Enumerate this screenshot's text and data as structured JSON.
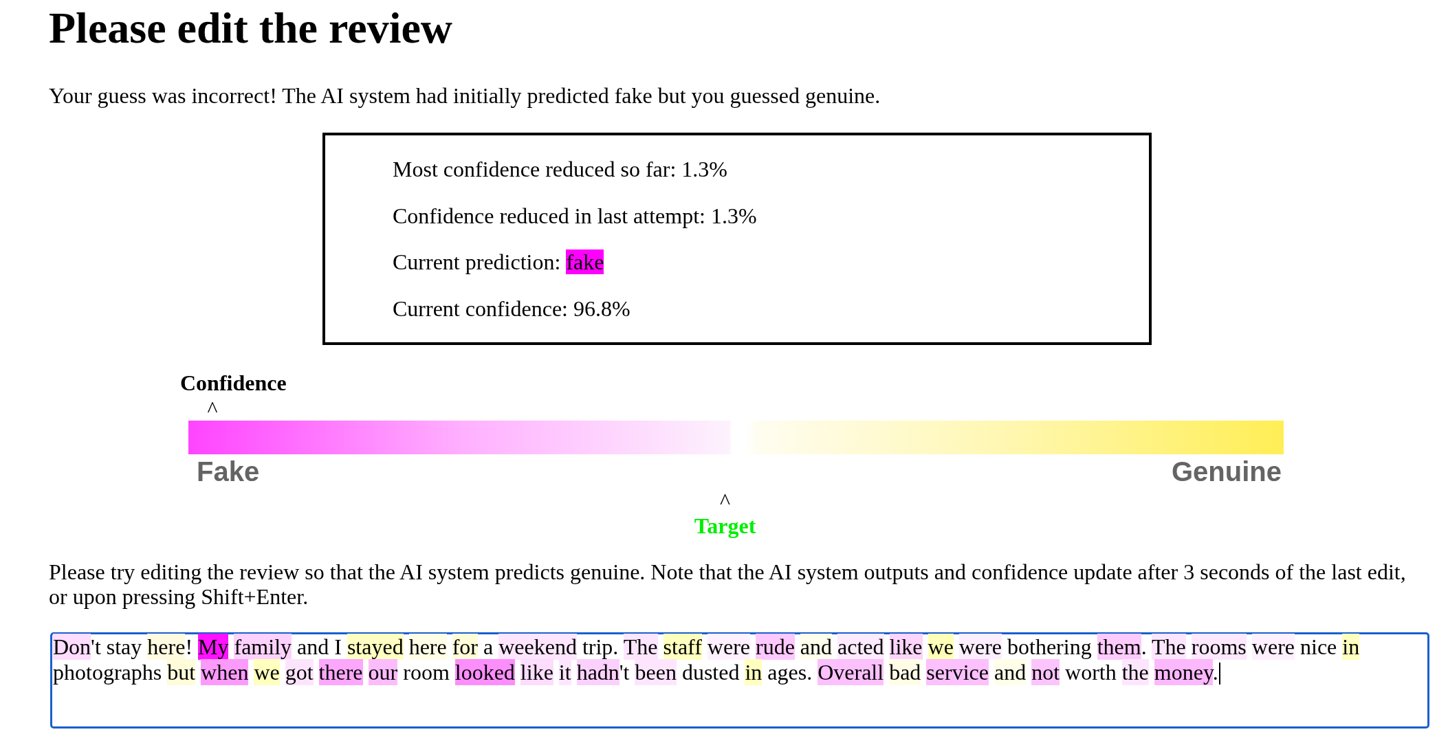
{
  "heading": "Please edit the review",
  "result_message": "Your guess was incorrect! The AI system had initially predicted fake but you guessed genuine.",
  "stats": [
    {
      "label": "Most confidence reduced so far:",
      "value": "1.3%"
    },
    {
      "label": "Confidence reduced in last attempt:",
      "value": "1.3%"
    },
    {
      "label": "Current prediction:",
      "value": "fake",
      "color": "#ff00ff"
    },
    {
      "label": "Current confidence:",
      "value": "96.8%"
    }
  ],
  "confidence_meter": {
    "title": "Confidence",
    "pointer": {
      "glyph": "^",
      "level": 0.022
    },
    "left_label": "Fake",
    "right_label": "Genuine",
    "target": {
      "glyph": "^",
      "label": "Target",
      "level": 0.49
    }
  },
  "instructions": "Please try editing the review so that the AI system predicts genuine. Note that the AI system outputs and confidence update after 3 seconds of the last edit, or upon pressing Shift+Enter.",
  "review": {
    "focused": true,
    "words": [
      {
        "text": "Don",
        "color": "#fddcfd",
        "suffix": "'t"
      },
      {
        "text": "stay"
      },
      {
        "text": "here",
        "color": "#fffbe1",
        "suffix": "!"
      },
      {
        "text": "My",
        "color": "#ff12ff"
      },
      {
        "text": "family",
        "color": "#fcd2fc"
      },
      {
        "text": "and"
      },
      {
        "text": "I"
      },
      {
        "text": "stayed",
        "color": "#ffffc2"
      },
      {
        "text": "here",
        "color": "#fffde6"
      },
      {
        "text": "for",
        "color": "#fffcd8"
      },
      {
        "text": "a"
      },
      {
        "text": "weekend",
        "color": "#fde6fd"
      },
      {
        "text": "trip."
      },
      {
        "text": "The",
        "color": "#fde6fd"
      },
      {
        "text": "staff",
        "color": "#ffffbe"
      },
      {
        "text": "were",
        "color": "#fef0fe"
      },
      {
        "text": "rude",
        "color": "#fdc8fd"
      },
      {
        "text": "and",
        "color": "#fffdeb"
      },
      {
        "text": "acted",
        "color": "#fdeafd"
      },
      {
        "text": "like",
        "color": "#fcd4fc"
      },
      {
        "text": "we",
        "color": "#ffffb8"
      },
      {
        "text": "were",
        "color": "#fdeefd"
      },
      {
        "text": "bothering"
      },
      {
        "text": "them",
        "color": "#fccafc",
        "suffix": "."
      },
      {
        "text": "The",
        "color": "#fde6fd"
      },
      {
        "text": "rooms",
        "color": "#fde8fd"
      },
      {
        "text": "were",
        "color": "#fef0fe"
      },
      {
        "text": "nice"
      },
      {
        "text": "in",
        "color": "#ffffbe"
      },
      {
        "text": "photographs"
      },
      {
        "text": "but",
        "color": "#fffcd9"
      },
      {
        "text": "when",
        "color": "#fc9afc"
      },
      {
        "text": "we",
        "color": "#ffffbe"
      },
      {
        "text": "got",
        "color": "#fde4fd"
      },
      {
        "text": "there",
        "color": "#fca6fc"
      },
      {
        "text": "our",
        "color": "#fcbcfc"
      },
      {
        "text": "room"
      },
      {
        "text": "looked",
        "color": "#fc8efc"
      },
      {
        "text": "like",
        "color": "#fddcfd"
      },
      {
        "text": "it",
        "color": "#fde6fd"
      },
      {
        "text": "hadn",
        "color": "#fcd0fc",
        "suffix": "'t"
      },
      {
        "text": "been",
        "color": "#fde6fd"
      },
      {
        "text": "dusted"
      },
      {
        "text": "in",
        "color": "#ffffbe"
      },
      {
        "text": "ages."
      },
      {
        "text": "Overall",
        "color": "#fcc0fc"
      },
      {
        "text": "bad",
        "color": "#fffde6"
      },
      {
        "text": "service",
        "color": "#fcc0fc"
      },
      {
        "text": "and",
        "color": "#fffee9"
      },
      {
        "text": "not",
        "color": "#fcc4fc"
      },
      {
        "text": "worth"
      },
      {
        "text": "the",
        "color": "#fde6fd"
      },
      {
        "text": "money",
        "color": "#fcb8fc",
        "suffix": "."
      }
    ]
  }
}
